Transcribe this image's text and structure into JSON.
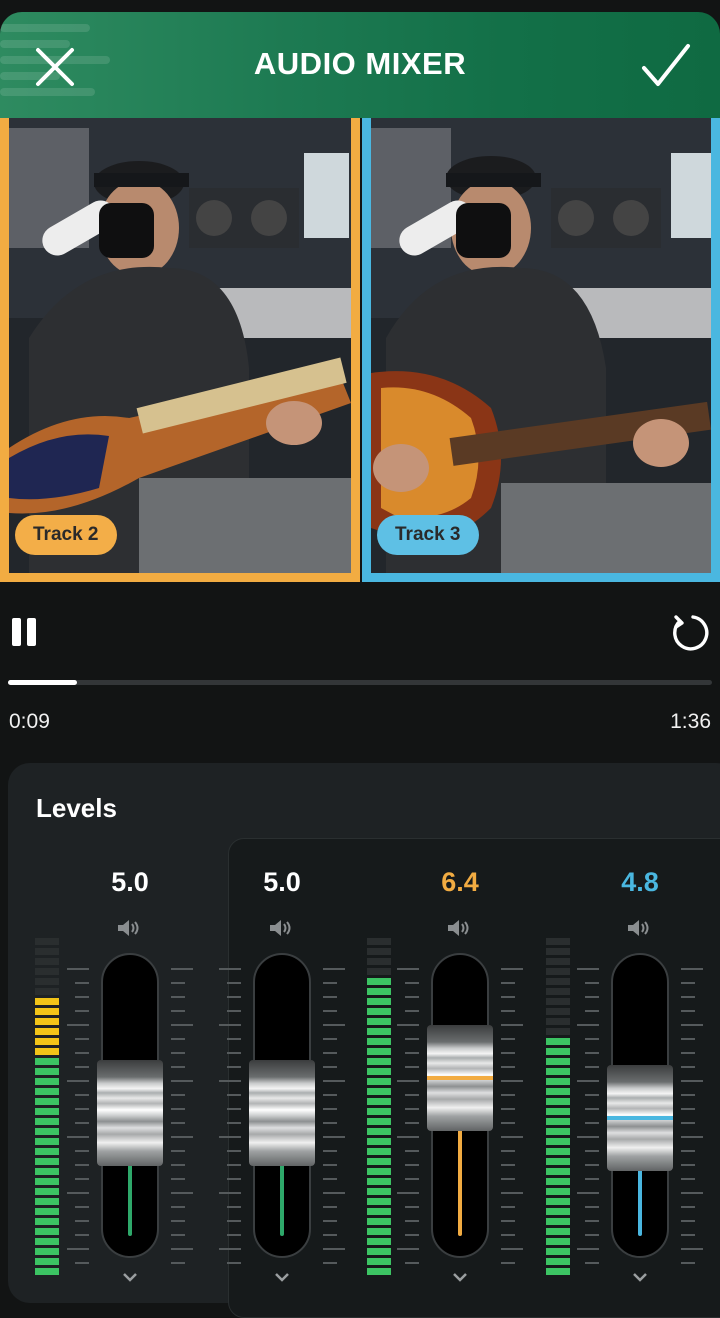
{
  "header": {
    "title": "AUDIO MIXER"
  },
  "colors": {
    "accent_green": "#1a7a50",
    "track2": "#f2ac42",
    "track3": "#4ab7e0",
    "meter_green": "#3cc463",
    "meter_yellow": "#f2c418"
  },
  "videos": [
    {
      "label": "Track 2",
      "border_color": "#f2ac42"
    },
    {
      "label": "Track 3",
      "border_color": "#4ab7e0"
    }
  ],
  "playback": {
    "current_time": "0:09",
    "total_time": "1:36",
    "progress": 0.098
  },
  "levels": {
    "title": "Levels",
    "channels": [
      {
        "value": "5.0",
        "level": 0.5,
        "color": "#ffffff",
        "line_color": "#2ea86a"
      },
      {
        "value": "5.0",
        "level": 0.5,
        "color": "#ffffff",
        "line_color": "#2ea86a"
      },
      {
        "value": "6.4",
        "level": 0.64,
        "color": "#f2ac42",
        "line_color": "#f2ac42"
      },
      {
        "value": "4.8",
        "level": 0.48,
        "color": "#4ab7e0",
        "line_color": "#4ab7e0"
      }
    ]
  },
  "icons": {
    "close": "close-icon",
    "confirm": "checkmark-icon",
    "pause": "pause-icon",
    "restart": "restart-icon",
    "speaker": "speaker-icon",
    "chevron": "chevron-down-icon"
  }
}
